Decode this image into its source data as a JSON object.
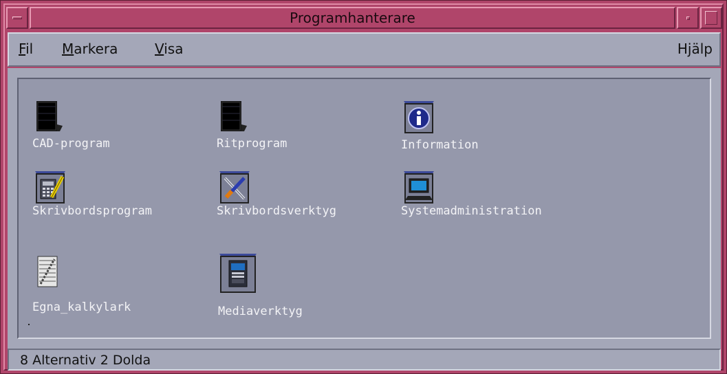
{
  "window": {
    "title": "Programhanterare"
  },
  "menubar": {
    "fil": {
      "mnemonic": "F",
      "rest": "il"
    },
    "markera": {
      "mnemonic": "M",
      "rest": "arkera"
    },
    "visa": {
      "mnemonic": "V",
      "rest": "isa"
    },
    "help": "Hjälp"
  },
  "icons": [
    {
      "label": "CAD-program",
      "icon": "closed-folder-icon"
    },
    {
      "label": "Ritprogram",
      "icon": "closed-folder-icon"
    },
    {
      "label": "Information",
      "icon": "info-folder-icon"
    },
    {
      "label": "Skrivbordsprogram",
      "icon": "desktop-apps-folder-icon"
    },
    {
      "label": "Skrivbordsverktyg",
      "icon": "desktop-tools-folder-icon"
    },
    {
      "label": "Systemadministration",
      "icon": "system-admin-folder-icon"
    },
    {
      "label": "Egna_kalkylark",
      "icon": "spreadsheet-file-icon"
    },
    {
      "label": "Mediaverktyg",
      "icon": "media-tools-folder-icon"
    }
  ],
  "status": {
    "text": "8 Alternativ 2 Dolda"
  },
  "colors": {
    "titlebar": "#b0456a",
    "panel": "#a4a7b8",
    "content": "#9598ab",
    "label_text": "#f3f3f6"
  }
}
